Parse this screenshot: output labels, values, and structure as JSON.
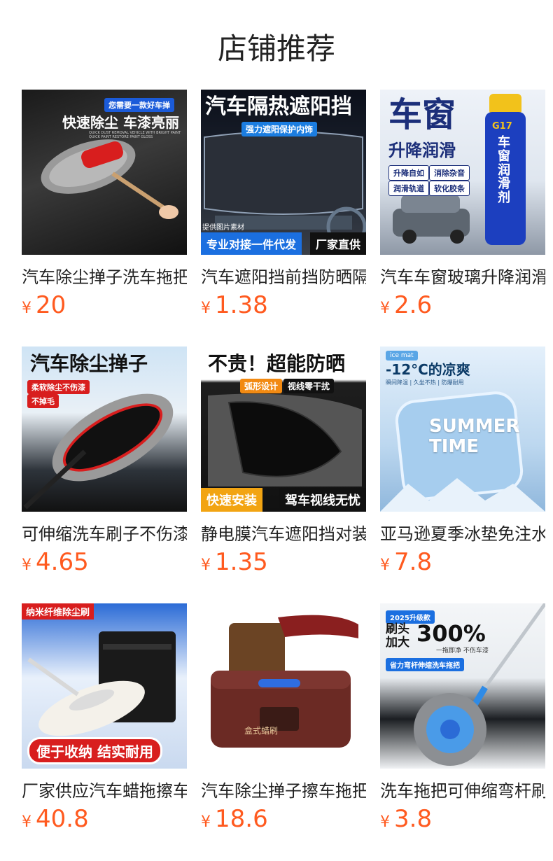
{
  "page": {
    "title": "店铺推荐"
  },
  "products": [
    {
      "title": "汽车除尘掸子洗车拖把",
      "price": "20",
      "currency": "¥",
      "image": {
        "headline": "快速除尘 车漆亮丽",
        "badge": "您需要一款好车掸",
        "caption": "QUICK DUST REMOVAL VEHICLE WITH BRIGHT PAINT QUICK PAINT RESTORE PAINT GLOSS"
      }
    },
    {
      "title": "汽车遮阳挡前挡防晒隔热",
      "price": "1.38",
      "currency": "¥",
      "image": {
        "headline": "汽车隔热遮阳挡",
        "badge": "强力遮阳保护内饰",
        "note": "提供图片素材",
        "banner_left": "专业对接一件代发",
        "banner_right": "厂家直供"
      }
    },
    {
      "title": "汽车车窗玻璃升降润滑剂",
      "price": "2.6",
      "currency": "¥",
      "image": {
        "headline": "车窗",
        "subheadline": "升降润滑",
        "tags": [
          "升降自如",
          "消除杂音",
          "润滑轨道",
          "软化胶条"
        ],
        "can_text": "车窗润滑剂",
        "can_label": "G17"
      }
    },
    {
      "title": "可伸缩洗车刷子不伤漆面",
      "price": "4.65",
      "currency": "¥",
      "image": {
        "headline": "汽车除尘掸子",
        "tags": [
          "柔软除尘不伤漆",
          "不掉毛"
        ]
      }
    },
    {
      "title": "静电膜汽车遮阳挡对装",
      "price": "1.35",
      "currency": "¥",
      "image": {
        "headline": "不贵！超能防晒",
        "tags": [
          "弧形设计",
          "视线零干扰"
        ],
        "banner_left": "快速安装",
        "banner_right": "驾车视线无忧"
      }
    },
    {
      "title": "亚马逊夏季冰垫免注水",
      "price": "7.8",
      "currency": "¥",
      "image": {
        "badge": "ice mat",
        "headline": "-12°C的凉爽",
        "subheadline": "瞬间降温 | 久坐不热 | 防爆耐用",
        "center_text": "SUMMER TIME"
      }
    },
    {
      "title": "厂家供应汽车蜡拖擦车",
      "price": "40.8",
      "currency": "¥",
      "image": {
        "badge": "纳米纤维除尘刷",
        "banner": "便于收纳 结实耐用"
      }
    },
    {
      "title": "汽车除尘掸子擦车拖把",
      "price": "18.6",
      "currency": "¥",
      "image": {
        "box_text": "盒式蜡刷"
      }
    },
    {
      "title": "洗车拖把可伸缩弯杆刷",
      "price": "3.8",
      "currency": "¥",
      "image": {
        "badge": "2025升级款",
        "headline_left": "刷头加大",
        "headline_big": "300%",
        "note": "一拖即净 不伤车漆",
        "banner": "省力弯杆伸缩洗车拖把"
      }
    }
  ]
}
